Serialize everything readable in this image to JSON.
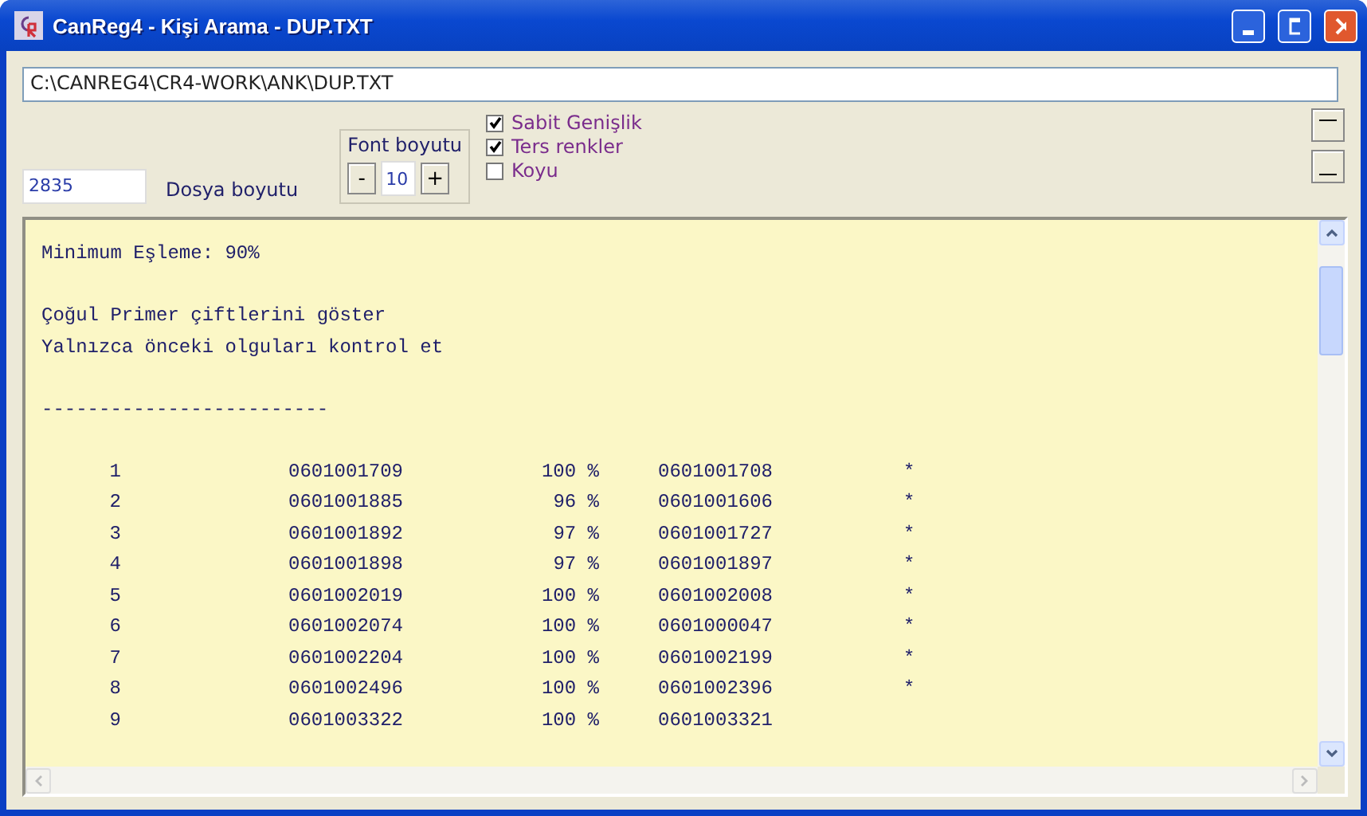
{
  "window": {
    "title": "CanReg4 - Kişi Arama - DUP.TXT"
  },
  "path_field": {
    "value": "C:\\CANREG4\\CR4-WORK\\ANK\\DUP.TXT"
  },
  "file_size": {
    "value": "2835",
    "label": "Dosya boyutu"
  },
  "font_size": {
    "label": "Font boyutu",
    "decrease": "-",
    "value": "10",
    "increase": "+"
  },
  "options": [
    {
      "label": "Sabit Genişlik",
      "checked": true
    },
    {
      "label": "Ters renkler",
      "checked": true
    },
    {
      "label": "Koyu",
      "checked": false
    }
  ],
  "report": {
    "header_blocks": [
      {
        "lines": [
          "Minimum Eşleme: 90%"
        ]
      },
      {
        "lines": [
          "Çoğul Primer çiftlerini göster",
          "Yalnızca önceki olguları kontrol et"
        ]
      },
      {
        "lines": [
          "-------------------------"
        ]
      }
    ],
    "rows": [
      {
        "index": "1",
        "record": "0601001709",
        "match": "100 %",
        "pair": "0601001708",
        "flag": "*"
      },
      {
        "index": "2",
        "record": "0601001885",
        "match": "96 %",
        "pair": "0601001606",
        "flag": "*"
      },
      {
        "index": "3",
        "record": "0601001892",
        "match": "97 %",
        "pair": "0601001727",
        "flag": "*"
      },
      {
        "index": "4",
        "record": "0601001898",
        "match": "97 %",
        "pair": "0601001897",
        "flag": "*"
      },
      {
        "index": "5",
        "record": "0601002019",
        "match": "100 %",
        "pair": "0601002008",
        "flag": "*"
      },
      {
        "index": "6",
        "record": "0601002074",
        "match": "100 %",
        "pair": "0601000047",
        "flag": "*"
      },
      {
        "index": "7",
        "record": "0601002204",
        "match": "100 %",
        "pair": "0601002199",
        "flag": "*"
      },
      {
        "index": "8",
        "record": "0601002496",
        "match": "100 %",
        "pair": "0601002396",
        "flag": "*"
      },
      {
        "index": "9",
        "record": "0601003322",
        "match": "100 %",
        "pair": "0601003321"
      }
    ]
  }
}
